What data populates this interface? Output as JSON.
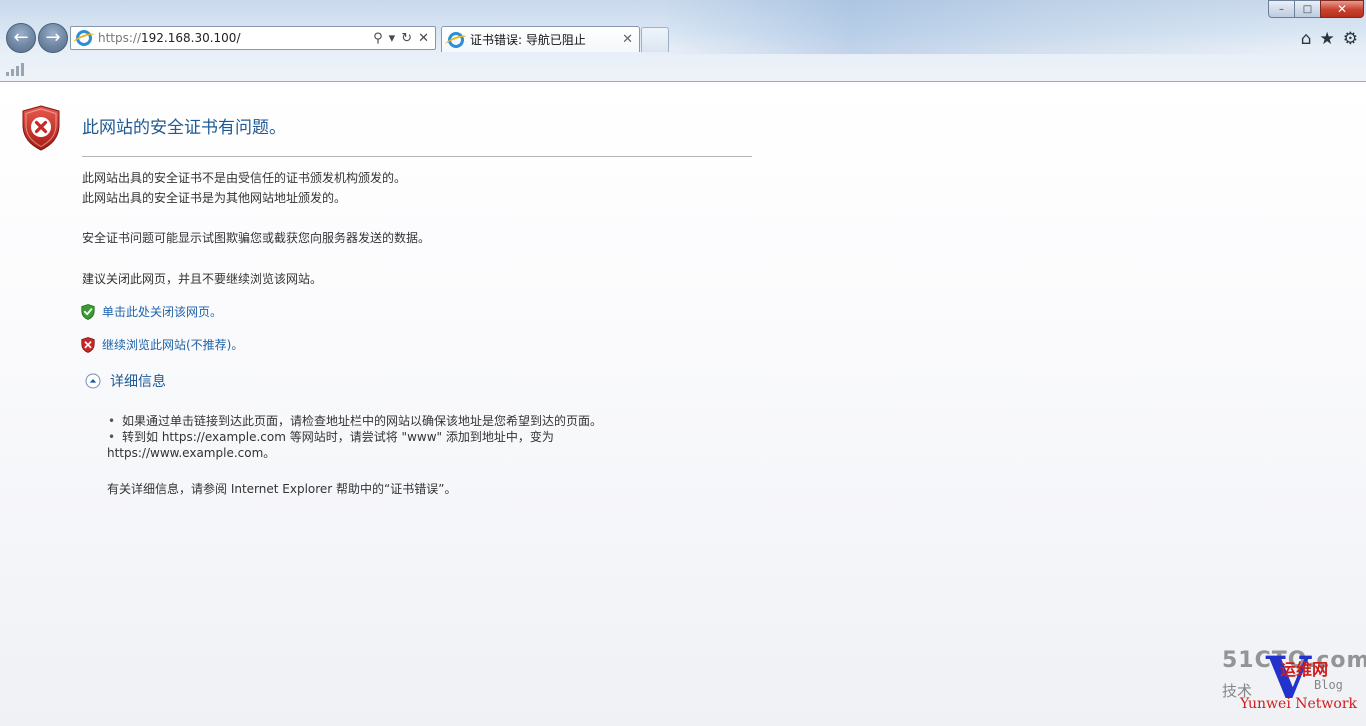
{
  "browser": {
    "address": {
      "scheme": "https://",
      "host": "192.168.30.100/"
    },
    "tab": {
      "title": "证书错误: 导航已阻止"
    },
    "icons": {
      "back": "back-arrow-icon",
      "forward": "forward-arrow-icon",
      "search": "search-icon",
      "dropdown": "chevron-down-icon",
      "refresh": "refresh-icon",
      "stop": "close-icon",
      "home": "home-icon",
      "favorites": "star-icon",
      "tools": "gear-icon"
    },
    "window": {
      "minimize": "–",
      "maximize": "□",
      "close": "✕"
    }
  },
  "page": {
    "heading": "此网站的安全证书有问题。",
    "paragraphs": {
      "cert_reason_1": "此网站出具的安全证书不是由受信任的证书颁发机构颁发的。",
      "cert_reason_2": "此网站出具的安全证书是为其他网站地址颁发的。",
      "warning": "安全证书问题可能显示试图欺骗您或截获您向服务器发送的数据。",
      "recommend": "建议关闭此网页，并且不要继续浏览该网站。"
    },
    "links": {
      "close_page": "单击此处关闭该网页。",
      "continue": "继续浏览此网站(不推荐)。"
    },
    "details": {
      "label": "详细信息",
      "bullets": [
        "如果通过单击链接到达此页面，请检查地址栏中的网站以确保该地址是您希望到达的页面。",
        "转到如 https://example.com 等网站时，请尝试将 \"www\" 添加到地址中，变为",
        "https://www.example.com。"
      ],
      "more_info": "有关详细信息，请参阅 Internet Explorer 帮助中的“证书错误”。"
    },
    "colors": {
      "heading": "#1f5a94",
      "link": "#1d63a8",
      "shield_red": "#c62828",
      "shield_green": "#3c9a32"
    }
  },
  "watermark": {
    "site": "51CTO.com",
    "tech": "技术",
    "cn": "运维网",
    "blog": "Blog",
    "brand": "Yunwei Network"
  }
}
